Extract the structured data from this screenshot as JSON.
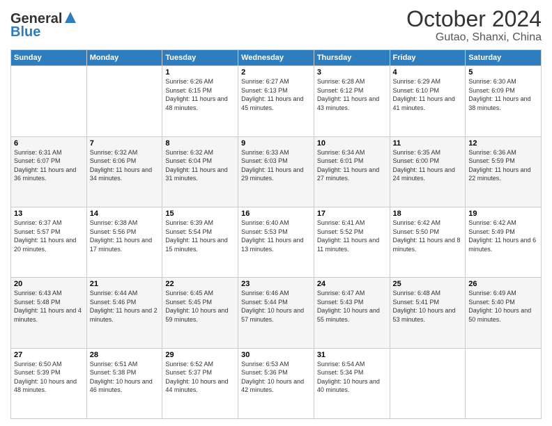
{
  "header": {
    "logo_line1": "General",
    "logo_line2": "Blue",
    "title": "October 2024",
    "subtitle": "Gutao, Shanxi, China"
  },
  "weekdays": [
    "Sunday",
    "Monday",
    "Tuesday",
    "Wednesday",
    "Thursday",
    "Friday",
    "Saturday"
  ],
  "weeks": [
    [
      {
        "day": "",
        "sunrise": "",
        "sunset": "",
        "daylight": ""
      },
      {
        "day": "",
        "sunrise": "",
        "sunset": "",
        "daylight": ""
      },
      {
        "day": "1",
        "sunrise": "Sunrise: 6:26 AM",
        "sunset": "Sunset: 6:15 PM",
        "daylight": "Daylight: 11 hours and 48 minutes."
      },
      {
        "day": "2",
        "sunrise": "Sunrise: 6:27 AM",
        "sunset": "Sunset: 6:13 PM",
        "daylight": "Daylight: 11 hours and 45 minutes."
      },
      {
        "day": "3",
        "sunrise": "Sunrise: 6:28 AM",
        "sunset": "Sunset: 6:12 PM",
        "daylight": "Daylight: 11 hours and 43 minutes."
      },
      {
        "day": "4",
        "sunrise": "Sunrise: 6:29 AM",
        "sunset": "Sunset: 6:10 PM",
        "daylight": "Daylight: 11 hours and 41 minutes."
      },
      {
        "day": "5",
        "sunrise": "Sunrise: 6:30 AM",
        "sunset": "Sunset: 6:09 PM",
        "daylight": "Daylight: 11 hours and 38 minutes."
      }
    ],
    [
      {
        "day": "6",
        "sunrise": "Sunrise: 6:31 AM",
        "sunset": "Sunset: 6:07 PM",
        "daylight": "Daylight: 11 hours and 36 minutes."
      },
      {
        "day": "7",
        "sunrise": "Sunrise: 6:32 AM",
        "sunset": "Sunset: 6:06 PM",
        "daylight": "Daylight: 11 hours and 34 minutes."
      },
      {
        "day": "8",
        "sunrise": "Sunrise: 6:32 AM",
        "sunset": "Sunset: 6:04 PM",
        "daylight": "Daylight: 11 hours and 31 minutes."
      },
      {
        "day": "9",
        "sunrise": "Sunrise: 6:33 AM",
        "sunset": "Sunset: 6:03 PM",
        "daylight": "Daylight: 11 hours and 29 minutes."
      },
      {
        "day": "10",
        "sunrise": "Sunrise: 6:34 AM",
        "sunset": "Sunset: 6:01 PM",
        "daylight": "Daylight: 11 hours and 27 minutes."
      },
      {
        "day": "11",
        "sunrise": "Sunrise: 6:35 AM",
        "sunset": "Sunset: 6:00 PM",
        "daylight": "Daylight: 11 hours and 24 minutes."
      },
      {
        "day": "12",
        "sunrise": "Sunrise: 6:36 AM",
        "sunset": "Sunset: 5:59 PM",
        "daylight": "Daylight: 11 hours and 22 minutes."
      }
    ],
    [
      {
        "day": "13",
        "sunrise": "Sunrise: 6:37 AM",
        "sunset": "Sunset: 5:57 PM",
        "daylight": "Daylight: 11 hours and 20 minutes."
      },
      {
        "day": "14",
        "sunrise": "Sunrise: 6:38 AM",
        "sunset": "Sunset: 5:56 PM",
        "daylight": "Daylight: 11 hours and 17 minutes."
      },
      {
        "day": "15",
        "sunrise": "Sunrise: 6:39 AM",
        "sunset": "Sunset: 5:54 PM",
        "daylight": "Daylight: 11 hours and 15 minutes."
      },
      {
        "day": "16",
        "sunrise": "Sunrise: 6:40 AM",
        "sunset": "Sunset: 5:53 PM",
        "daylight": "Daylight: 11 hours and 13 minutes."
      },
      {
        "day": "17",
        "sunrise": "Sunrise: 6:41 AM",
        "sunset": "Sunset: 5:52 PM",
        "daylight": "Daylight: 11 hours and 11 minutes."
      },
      {
        "day": "18",
        "sunrise": "Sunrise: 6:42 AM",
        "sunset": "Sunset: 5:50 PM",
        "daylight": "Daylight: 11 hours and 8 minutes."
      },
      {
        "day": "19",
        "sunrise": "Sunrise: 6:42 AM",
        "sunset": "Sunset: 5:49 PM",
        "daylight": "Daylight: 11 hours and 6 minutes."
      }
    ],
    [
      {
        "day": "20",
        "sunrise": "Sunrise: 6:43 AM",
        "sunset": "Sunset: 5:48 PM",
        "daylight": "Daylight: 11 hours and 4 minutes."
      },
      {
        "day": "21",
        "sunrise": "Sunrise: 6:44 AM",
        "sunset": "Sunset: 5:46 PM",
        "daylight": "Daylight: 11 hours and 2 minutes."
      },
      {
        "day": "22",
        "sunrise": "Sunrise: 6:45 AM",
        "sunset": "Sunset: 5:45 PM",
        "daylight": "Daylight: 10 hours and 59 minutes."
      },
      {
        "day": "23",
        "sunrise": "Sunrise: 6:46 AM",
        "sunset": "Sunset: 5:44 PM",
        "daylight": "Daylight: 10 hours and 57 minutes."
      },
      {
        "day": "24",
        "sunrise": "Sunrise: 6:47 AM",
        "sunset": "Sunset: 5:43 PM",
        "daylight": "Daylight: 10 hours and 55 minutes."
      },
      {
        "day": "25",
        "sunrise": "Sunrise: 6:48 AM",
        "sunset": "Sunset: 5:41 PM",
        "daylight": "Daylight: 10 hours and 53 minutes."
      },
      {
        "day": "26",
        "sunrise": "Sunrise: 6:49 AM",
        "sunset": "Sunset: 5:40 PM",
        "daylight": "Daylight: 10 hours and 50 minutes."
      }
    ],
    [
      {
        "day": "27",
        "sunrise": "Sunrise: 6:50 AM",
        "sunset": "Sunset: 5:39 PM",
        "daylight": "Daylight: 10 hours and 48 minutes."
      },
      {
        "day": "28",
        "sunrise": "Sunrise: 6:51 AM",
        "sunset": "Sunset: 5:38 PM",
        "daylight": "Daylight: 10 hours and 46 minutes."
      },
      {
        "day": "29",
        "sunrise": "Sunrise: 6:52 AM",
        "sunset": "Sunset: 5:37 PM",
        "daylight": "Daylight: 10 hours and 44 minutes."
      },
      {
        "day": "30",
        "sunrise": "Sunrise: 6:53 AM",
        "sunset": "Sunset: 5:36 PM",
        "daylight": "Daylight: 10 hours and 42 minutes."
      },
      {
        "day": "31",
        "sunrise": "Sunrise: 6:54 AM",
        "sunset": "Sunset: 5:34 PM",
        "daylight": "Daylight: 10 hours and 40 minutes."
      },
      {
        "day": "",
        "sunrise": "",
        "sunset": "",
        "daylight": ""
      },
      {
        "day": "",
        "sunrise": "",
        "sunset": "",
        "daylight": ""
      }
    ]
  ]
}
